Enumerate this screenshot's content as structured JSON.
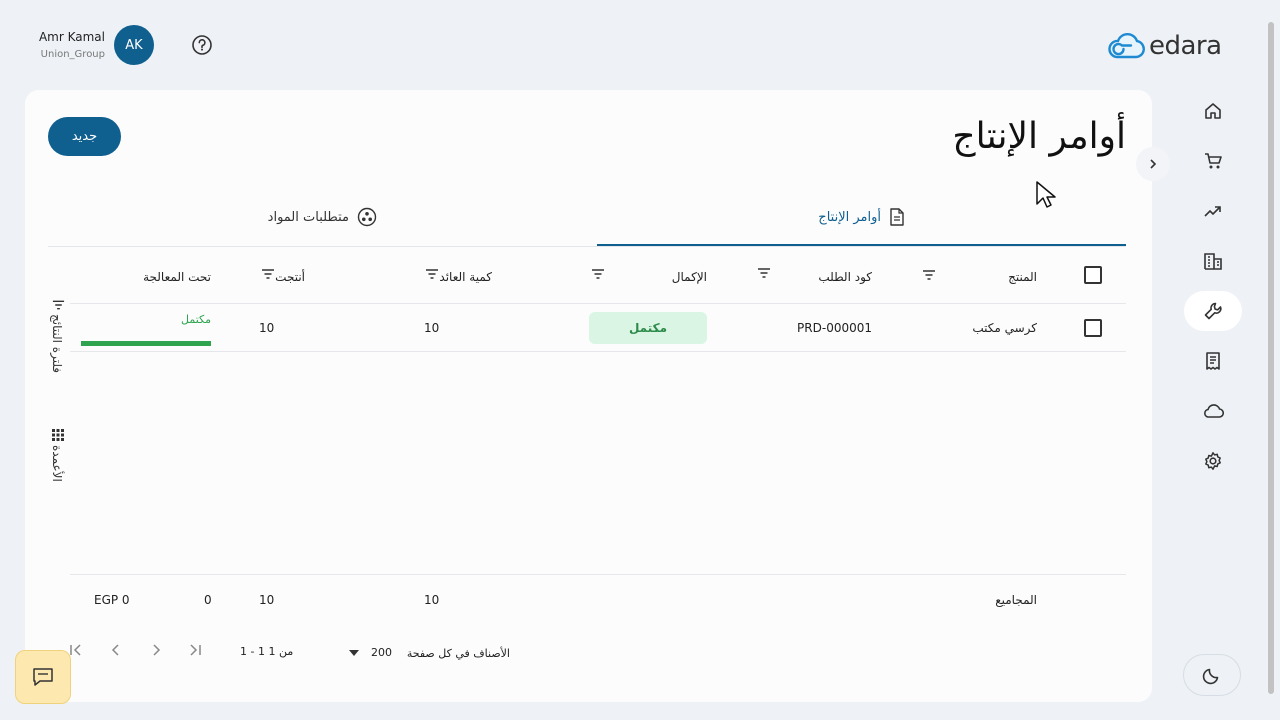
{
  "header": {
    "user_name": "Amr Kamal",
    "user_org": "Union_Group",
    "avatar_initials": "AK",
    "logo_text": "edara"
  },
  "colors": {
    "primary": "#0f5f8f",
    "success": "#2ea44f",
    "badge_bg": "#daf5e3",
    "chat_bg": "#fde9b0"
  },
  "sidebar": {
    "items": [
      {
        "icon": "home-icon"
      },
      {
        "icon": "cart-icon"
      },
      {
        "icon": "trending-up-icon"
      },
      {
        "icon": "buildings-icon"
      },
      {
        "icon": "wrench-icon",
        "active": true
      },
      {
        "icon": "receipt-icon"
      },
      {
        "icon": "cloud-icon"
      },
      {
        "icon": "gear-icon"
      }
    ],
    "theme_icon": "moon-icon"
  },
  "page": {
    "title": "أوامر الإنتاج",
    "new_button": "جديد"
  },
  "tabs": [
    {
      "label": "أوامر الإنتاج",
      "icon": "document-icon",
      "active": true
    },
    {
      "label": "متطلبات المواد",
      "icon": "materials-icon",
      "active": false
    }
  ],
  "table": {
    "headers": {
      "product": "المنتج",
      "order_code": "كود الطلب",
      "completion": "الإكمال",
      "returned_qty": "كمية العائد",
      "produced": "أنتجت",
      "in_progress": "تحت المعالجة"
    },
    "rows": [
      {
        "product": "كرسي مكتب",
        "order_code": "PRD-000001",
        "completion": "مكتمل",
        "returned_qty": "10",
        "produced": "10",
        "progress_label": "مكتمل",
        "progress": 1.0
      }
    ],
    "totals": {
      "label": "المجاميع",
      "returned_qty": "10",
      "produced": "10",
      "count": "0",
      "amount": "EGP 0"
    }
  },
  "side_panel": {
    "filter_label": "فلترة النتائج",
    "columns_label": "الأعمدة"
  },
  "pagination": {
    "per_page_label": "الأصناف في كل صفحة",
    "per_page_value": "200",
    "range": "1 - 1 من 1"
  }
}
